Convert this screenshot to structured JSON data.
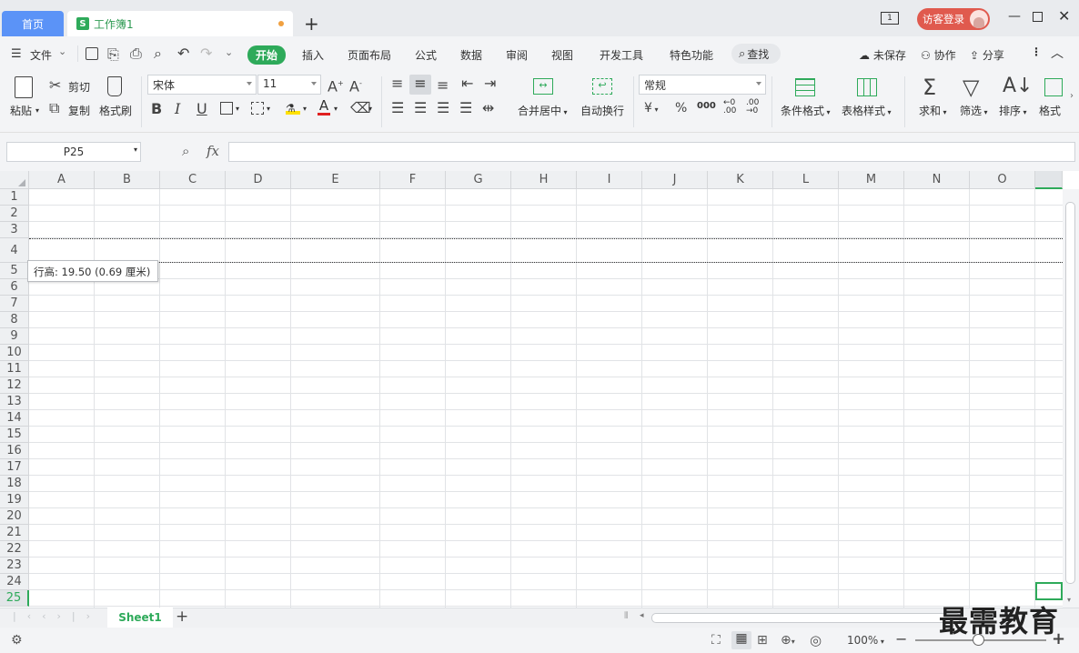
{
  "tabs": {
    "home": "首页",
    "doc": "工作簿1",
    "doc_icon": "S"
  },
  "titlebar": {
    "page_indicator": "1",
    "login": "访客登录"
  },
  "menu": {
    "file": "文件",
    "items": [
      "开始",
      "插入",
      "页面布局",
      "公式",
      "数据",
      "审阅",
      "视图",
      "开发工具",
      "特色功能"
    ],
    "search": "查找",
    "unsaved": "未保存",
    "collab": "协作",
    "share": "分享"
  },
  "ribbon": {
    "paste": "粘贴",
    "cut": "剪切",
    "copy": "复制",
    "format_painter": "格式刷",
    "font_name": "宋体",
    "font_size": "11",
    "merge": "合并居中",
    "wrap": "自动换行",
    "number_format": "常规",
    "cond_format": "条件格式",
    "table_style": "表格样式",
    "sum": "求和",
    "filter": "筛选",
    "sort": "排序",
    "format": "格式",
    "currency": "¥",
    "percent": "%",
    "thousands": "000"
  },
  "formula": {
    "cell_ref": "P25",
    "fx": "fx"
  },
  "columns": [
    "A",
    "B",
    "C",
    "D",
    "E",
    "F",
    "G",
    "H",
    "I",
    "J",
    "K",
    "L",
    "M",
    "N",
    "O"
  ],
  "rows": [
    "1",
    "2",
    "3",
    "4",
    "5",
    "6",
    "7",
    "8",
    "9",
    "10",
    "11",
    "12",
    "13",
    "14",
    "15",
    "16",
    "17",
    "18",
    "19",
    "20",
    "21",
    "22",
    "23",
    "24",
    "25"
  ],
  "tooltip": "行高: 19.50 (0.69 厘米)",
  "sheet_tab": "Sheet1",
  "status": {
    "zoom": "100%"
  },
  "watermark": "最需教育",
  "colors": {
    "accent": "#2eaa5a",
    "home_tab": "#5b93f7",
    "login": "#e05a4e"
  }
}
